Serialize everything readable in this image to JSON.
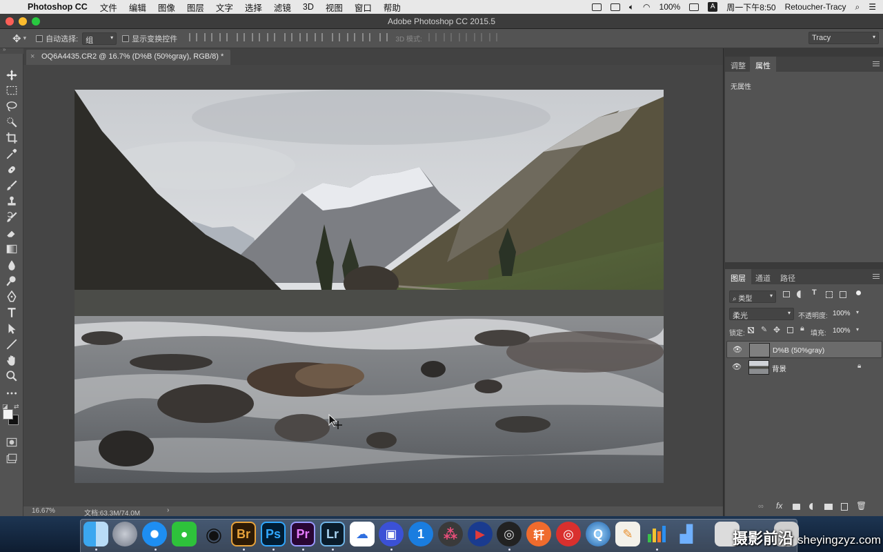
{
  "menubar": {
    "app_name": "Photoshop CC",
    "items": [
      "文件",
      "编辑",
      "图像",
      "图层",
      "文字",
      "选择",
      "滤镜",
      "3D",
      "视图",
      "窗口",
      "帮助"
    ],
    "battery": "100%",
    "input_source": "A",
    "clock": "周一下午8:50",
    "user": "Retoucher-Tracy"
  },
  "window": {
    "title": "Adobe Photoshop CC 2015.5"
  },
  "options": {
    "auto_select_label": "自动选择:",
    "auto_select_value": "组",
    "show_transform_label": "显示变换控件",
    "mode_3d_label": "3D 模式:",
    "workspace": "Tracy"
  },
  "document": {
    "tab_title": "OQ6A4435.CR2 @ 16.7% (D%B  (50%gray), RGB/8) *",
    "zoom": "16.67%",
    "doc_size": "文档:63.3M/74.0M"
  },
  "properties_panel": {
    "tabs": [
      "调整",
      "属性"
    ],
    "active_tab": "属性",
    "empty_text": "无属性"
  },
  "layers_panel": {
    "tabs": [
      "图层",
      "通道",
      "路径"
    ],
    "active_tab": "图层",
    "filter_label": "类型",
    "blend_mode": "柔光",
    "opacity_label": "不透明度:",
    "opacity_value": "100%",
    "lock_label": "锁定:",
    "fill_label": "填充:",
    "fill_value": "100%",
    "layers": [
      {
        "name": "D%B  (50%gray)",
        "selected": true,
        "locked": false
      },
      {
        "name": "背景",
        "selected": false,
        "locked": true
      }
    ]
  },
  "dock": {
    "apps": [
      "Finder",
      "Launchpad",
      "Safari",
      "WeChat",
      "QQ",
      "Br",
      "Ps",
      "Pr",
      "Lr",
      "Baidu Netdisk",
      "Screenshot",
      "1Password",
      "DaVinci Resolve",
      "Video Player",
      "OBS",
      "Translator",
      "NetEase Music",
      "QuickTime",
      "Pages",
      "Numbers",
      "Keynote"
    ]
  },
  "watermark": {
    "text": "摄影前沿",
    "domain": "sheyingzyz.com"
  },
  "colors": {
    "panel": "#535353",
    "canvas_bg": "#454545",
    "accent_selected": "#6b6b6b"
  }
}
